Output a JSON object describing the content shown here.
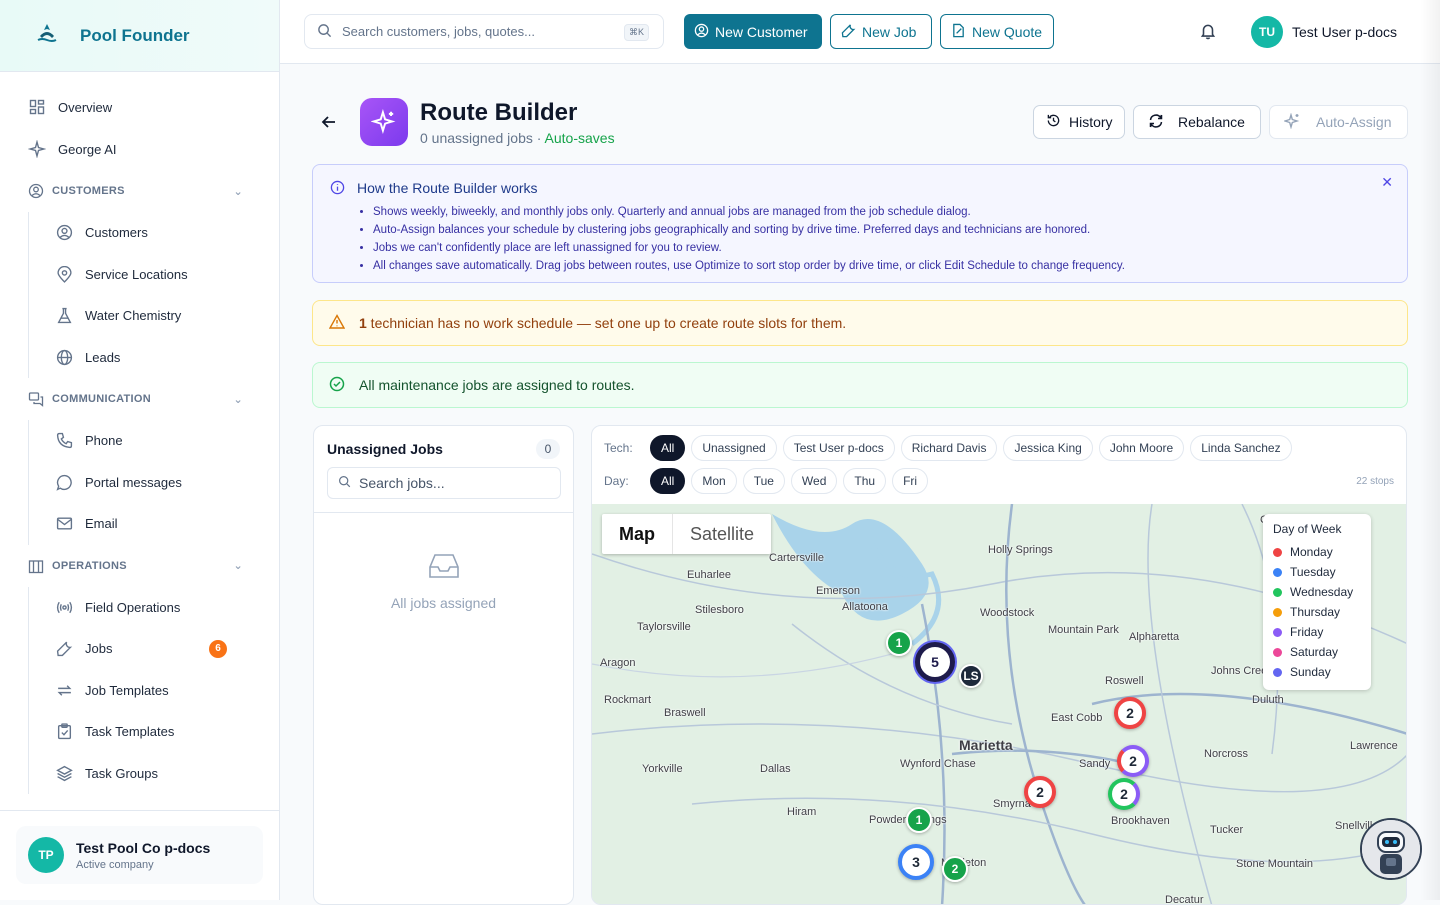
{
  "brand": {
    "name": "Pool Founder"
  },
  "sidebar": {
    "top": [
      {
        "label": "Overview",
        "icon": "grid-icon"
      },
      {
        "label": "George AI",
        "icon": "sparkles-icon"
      }
    ],
    "customers": {
      "title": "CUSTOMERS",
      "items": [
        "Customers",
        "Service Locations",
        "Water Chemistry",
        "Leads"
      ]
    },
    "communication": {
      "title": "COMMUNICATION",
      "items": [
        "Phone",
        "Portal messages",
        "Email"
      ]
    },
    "operations": {
      "title": "OPERATIONS",
      "items": [
        "Field Operations",
        "Jobs",
        "Job Templates",
        "Task Templates",
        "Task Groups"
      ],
      "jobs_badge": "6"
    },
    "company": {
      "initials": "TP",
      "name": "Test Pool Co p-docs",
      "status": "Active company"
    }
  },
  "topbar": {
    "search_placeholder": "Search customers, jobs, quotes...",
    "shortcut": "⌘K",
    "new_customer": "New Customer",
    "new_job": "New Job",
    "new_quote": "New Quote",
    "user_initials": "TU",
    "user_name": "Test User p-docs"
  },
  "page": {
    "title": "Route Builder",
    "subtitle": "0 unassigned jobs",
    "autosave": "Auto-saves",
    "history": "History",
    "rebalance": "Rebalance",
    "auto_assign": "Auto-Assign"
  },
  "info": {
    "title": "How the Route Builder works",
    "bullets": [
      "Shows weekly, biweekly, and monthly jobs only. Quarterly and annual jobs are managed from the job schedule dialog.",
      "Auto-Assign balances your schedule by clustering jobs geographically and sorting by drive time. Preferred days and technicians are honored.",
      "Jobs we can't confidently place are left unassigned for you to review.",
      "All changes save automatically. Drag jobs between routes, use Optimize to sort stop order by drive time, or click Edit Schedule to change frequency."
    ]
  },
  "warning": {
    "count": "1",
    "text": " technician has no work schedule — set one up to create route slots for them."
  },
  "success": {
    "text": "All maintenance jobs are assigned to routes."
  },
  "unassigned": {
    "title": "Unassigned Jobs",
    "count": "0",
    "search_placeholder": "Search jobs...",
    "empty": "All jobs assigned"
  },
  "filters": {
    "tech_label": "Tech:",
    "techs": [
      "All",
      "Unassigned",
      "Test User p-docs",
      "Richard Davis",
      "Jessica King",
      "John Moore",
      "Linda Sanchez"
    ],
    "day_label": "Day:",
    "days": [
      "All",
      "Mon",
      "Tue",
      "Wed",
      "Thu",
      "Fri"
    ],
    "stops": "22 stops"
  },
  "map": {
    "map_label": "Map",
    "satellite_label": "Satellite",
    "legend_title": "Day of Week",
    "legend": [
      {
        "day": "Monday",
        "color": "#ef4444"
      },
      {
        "day": "Tuesday",
        "color": "#3b82f6"
      },
      {
        "day": "Wednesday",
        "color": "#22c55e"
      },
      {
        "day": "Thursday",
        "color": "#f59e0b"
      },
      {
        "day": "Friday",
        "color": "#8b5cf6"
      },
      {
        "day": "Saturday",
        "color": "#ec4899"
      },
      {
        "day": "Sunday",
        "color": "#6366f1"
      }
    ],
    "places": [
      "Cartersville",
      "Holly Springs",
      "Euharlee",
      "Emerson",
      "Stilesboro",
      "Allatoona",
      "Woodstock",
      "Mountain Park",
      "Alpharetta",
      "Taylorsville",
      "Aragon",
      "Roswell",
      "Johns Creek",
      "Duluth",
      "Rockmart",
      "Braswell",
      "East Cobb",
      "Marietta",
      "Sandy",
      "Norcross",
      "Yorkville",
      "Dallas",
      "Wynford Chase",
      "Smyrna",
      "Hiram",
      "Powder Springs",
      "Brookhaven",
      "Tucker",
      "Stone Mountain",
      "Decatur",
      "Mableton",
      "Snellville",
      "Lawrence",
      "Cumming"
    ],
    "clusters": [
      {
        "label": "1",
        "type": "green"
      },
      {
        "label": "5",
        "type": "navy"
      },
      {
        "label": "LS",
        "type": "dark"
      },
      {
        "label": "2",
        "type": "red"
      },
      {
        "label": "2",
        "type": "mixed-blue"
      },
      {
        "label": "2",
        "type": "red"
      },
      {
        "label": "2",
        "type": "mixed-green"
      },
      {
        "label": "1",
        "type": "green"
      },
      {
        "label": "3",
        "type": "blue"
      },
      {
        "label": "2",
        "type": "green"
      }
    ]
  }
}
